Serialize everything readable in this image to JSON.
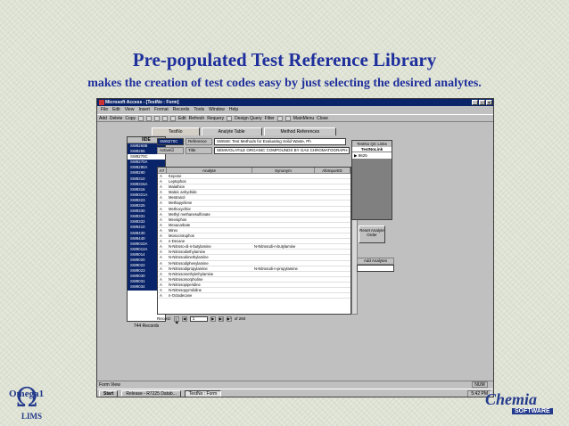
{
  "slide": {
    "title": "Pre-populated Test Reference Library",
    "subtitle": "makes the creation of test codes easy by just selecting the desired analytes."
  },
  "window": {
    "title": "Microsoft Access - [TestNo : Form]",
    "menu": [
      "File",
      "Edit",
      "View",
      "Insert",
      "Format",
      "Records",
      "Tools",
      "Window",
      "Help"
    ],
    "toolbar": [
      "Add",
      "Delete",
      "Copy",
      "Edit",
      "Refresh",
      "Requery",
      "Design Query",
      "Filter",
      "MainMenu",
      "Close"
    ]
  },
  "tabs": [
    "TestNo",
    "Analyte Table",
    "Method References"
  ],
  "left_list": {
    "header": "IIDE",
    "items": [
      "SW8260B",
      "SW8265",
      "SW8270C",
      "SW8270A",
      "SW8280A",
      "SW8290",
      "SW8310",
      "SW8315A",
      "SW8316",
      "SW8321A",
      "SW8323",
      "SW8325",
      "SW8330",
      "SW8331",
      "SW8332",
      "SW8410",
      "SW8430",
      "SW8440",
      "SW9010A",
      "SW9012A",
      "SW9014",
      "SW9020",
      "SW9022",
      "SW9023",
      "SW9030",
      "SW9031",
      "SW9034"
    ],
    "selected_index": 2,
    "count": "744",
    "count_label": "Records"
  },
  "top_fields": {
    "test_code": "SW8270C",
    "reference_label": "Reference",
    "reference_value": "SW846: Test Methods for Evaluating Solid Waste, Ph",
    "active_label": "Active",
    "active_check": "☑",
    "title_label": "Title",
    "title_value": "SEMIVOLATILE ORGANIC COMPOUNDS BY GAS CHROMATOGRAPH"
  },
  "grid": {
    "headers": [
      "A?",
      "Analyte",
      "Synonym",
      "AltImportID"
    ],
    "rows": [
      [
        "A",
        "Kepone",
        ""
      ],
      [
        "A",
        "Leptophos",
        ""
      ],
      [
        "A",
        "Malathion",
        ""
      ],
      [
        "A",
        "Maleic anhydride",
        ""
      ],
      [
        "A",
        "Mestranol",
        ""
      ],
      [
        "A",
        "Methapyrilene",
        ""
      ],
      [
        "A",
        "Methoxychlor",
        ""
      ],
      [
        "A",
        "Methyl methanesulfonate",
        ""
      ],
      [
        "A",
        "Mevinphos",
        ""
      ],
      [
        "A",
        "Mexacarbate",
        ""
      ],
      [
        "A",
        "Mirex",
        ""
      ],
      [
        "A",
        "Monocrotophos",
        ""
      ],
      [
        "A",
        "n-Decane",
        ""
      ],
      [
        "A",
        "N-Nitroso-di-n-butylamine",
        "N-Nitrosodi-n-butylamine"
      ],
      [
        "A",
        "N-Nitrosodiethylamine",
        ""
      ],
      [
        "A",
        "N-Nitrosodimethylamine",
        ""
      ],
      [
        "A",
        "N-Nitrosodiphenylamine",
        ""
      ],
      [
        "A",
        "N-Nitrosodipropylamine",
        "N-Nitrosodi-n-propylamine"
      ],
      [
        "A",
        "N-Nitrosomethylethylamine",
        ""
      ],
      [
        "A",
        "N-Nitrosomorpholine",
        ""
      ],
      [
        "A",
        "N-Nitrosopiperidine",
        ""
      ],
      [
        "A",
        "N-Nitrosopyrrolidine",
        ""
      ],
      [
        "A",
        "n-Octadecane",
        ""
      ]
    ]
  },
  "record_nav": {
    "label": "Record:",
    "current": "1",
    "total": "of 260"
  },
  "right_panel": {
    "header": "TestNo QC Links",
    "subheader": "TestNoLink",
    "row": "8625",
    "reset_button": "Reset Analyte Order",
    "add_label": "Add Analytes"
  },
  "status": {
    "text": "Form View",
    "num": "NUM"
  },
  "taskbar": {
    "start": "Start",
    "items": [
      "Release - R7225  Datab...",
      "TestNo : Form"
    ],
    "clock": "5:42 PM"
  },
  "logo_left": {
    "name": "Omega",
    "suffix": "1",
    "product": "LIMS"
  },
  "logo_right": {
    "name": "Chemia",
    "product": "SOFTWARE"
  }
}
